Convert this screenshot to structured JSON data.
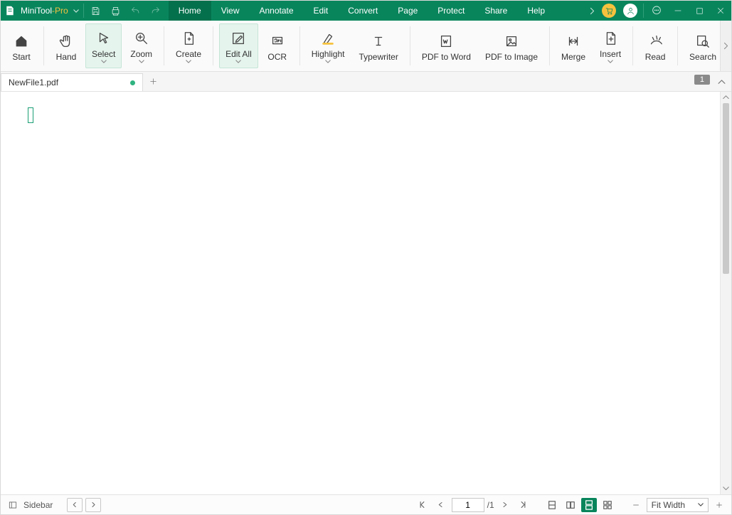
{
  "app": {
    "name1": "MiniTool",
    "name2": "-Pro"
  },
  "menus": [
    "Home",
    "View",
    "Annotate",
    "Edit",
    "Convert",
    "Page",
    "Protect",
    "Share",
    "Help"
  ],
  "active_menu": "Home",
  "ribbon": {
    "start": {
      "label": "Start"
    },
    "hand": {
      "label": "Hand"
    },
    "select": {
      "label": "Select"
    },
    "zoom": {
      "label": "Zoom"
    },
    "create": {
      "label": "Create"
    },
    "editall": {
      "label": "Edit All"
    },
    "ocr": {
      "label": "OCR"
    },
    "highlight": {
      "label": "Highlight"
    },
    "typewriter": {
      "label": "Typewriter"
    },
    "pdf2word": {
      "label": "PDF to Word"
    },
    "pdf2image": {
      "label": "PDF to Image"
    },
    "merge": {
      "label": "Merge"
    },
    "insert": {
      "label": "Insert"
    },
    "read": {
      "label": "Read"
    },
    "search": {
      "label": "Search"
    }
  },
  "tab": {
    "title": "NewFile1.pdf",
    "page_badge": "1"
  },
  "status": {
    "sidebar_label": "Sidebar",
    "page_current": "1",
    "page_total": "/1",
    "zoom_label": "Fit Width"
  }
}
